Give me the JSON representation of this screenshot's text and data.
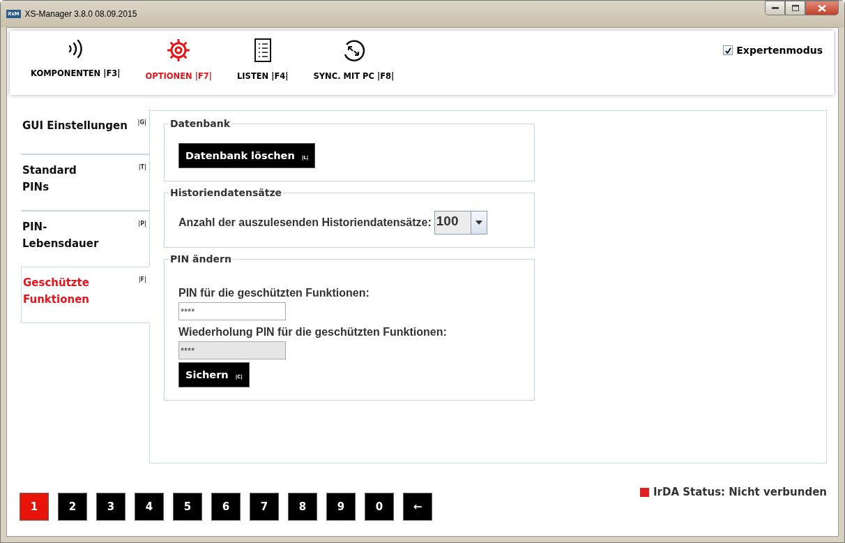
{
  "window": {
    "title": "XS-Manager 3.8.0 08.09.2015",
    "logo": "XsM"
  },
  "toolbar": {
    "items": [
      {
        "kind": "wireless",
        "label": "KOMPONENTEN |F3|",
        "selected": false
      },
      {
        "kind": "gear",
        "label": "OPTIONEN |F7|",
        "selected": true
      },
      {
        "kind": "list",
        "label": "LISTEN |F4|",
        "selected": false
      },
      {
        "kind": "sync",
        "label": "SYNC. MIT PC |F8|",
        "selected": false
      }
    ],
    "expert_mode": {
      "label": "Expertenmodus",
      "checked": true
    }
  },
  "sidebar": {
    "items": [
      {
        "label": "GUI Einstellungen",
        "shortcut": "|G|",
        "selected": false
      },
      {
        "label": "Standard\nPINs",
        "shortcut": "|T|",
        "selected": false
      },
      {
        "label": "PIN-\nLebensdauer",
        "shortcut": "|P|",
        "selected": false
      },
      {
        "label": "Geschützte\nFunktionen",
        "shortcut": "|F|",
        "selected": true
      }
    ]
  },
  "groups": [
    {
      "kind": "button",
      "title": "Datenbank",
      "button": {
        "label": "Datenbank löschen",
        "shortcut": "|L|"
      }
    },
    {
      "kind": "dropdown",
      "title": "Historiendatensätze",
      "label": "Anzahl der auszulesenden Historiendatensätze:",
      "value": "100"
    },
    {
      "kind": "pin",
      "title": "PIN ändern",
      "fields": [
        {
          "label": "PIN für die geschützten Funktionen:",
          "value": "****",
          "disabled": false
        },
        {
          "label": "Wiederholung PIN für die geschützten Funktionen:",
          "value": "****",
          "disabled": true
        }
      ],
      "button": {
        "label": "Sichern",
        "shortcut": "|C|"
      }
    }
  ],
  "keypad": [
    {
      "label": "1",
      "selected": true
    },
    {
      "label": "2",
      "selected": false
    },
    {
      "label": "3",
      "selected": false
    },
    {
      "label": "4",
      "selected": false
    },
    {
      "label": "5",
      "selected": false
    },
    {
      "label": "6",
      "selected": false
    },
    {
      "label": "7",
      "selected": false
    },
    {
      "label": "8",
      "selected": false
    },
    {
      "label": "9",
      "selected": false
    },
    {
      "label": "0",
      "selected": false
    },
    {
      "label": "←",
      "selected": false
    }
  ],
  "status": {
    "text": "IrDA Status: Nicht verbunden",
    "color": "#e02020"
  }
}
